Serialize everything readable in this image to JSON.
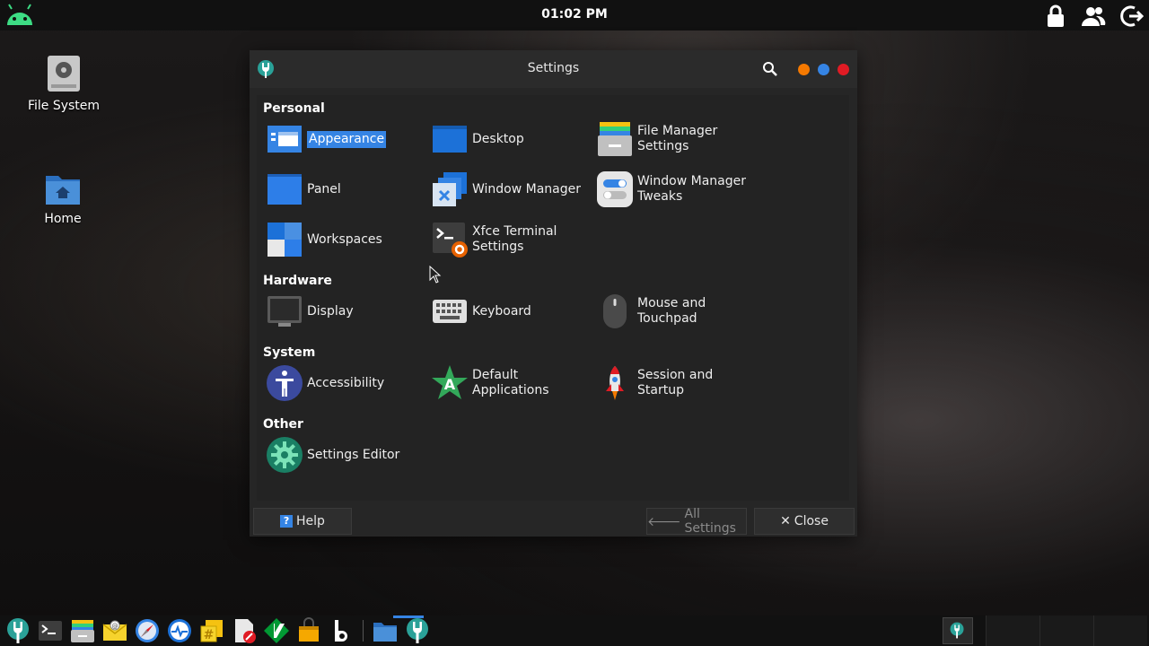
{
  "topbar": {
    "clock": "01:02 PM",
    "left_icon": "android-icon",
    "right_icons": [
      "lock-icon",
      "users-icon",
      "logout-icon"
    ]
  },
  "desktop": {
    "icons": [
      {
        "label": "File System",
        "icon": "drive-icon"
      },
      {
        "label": "Home",
        "icon": "home-folder-icon"
      }
    ]
  },
  "window": {
    "title": "Settings",
    "sections": [
      {
        "title": "Personal",
        "items": [
          {
            "label": "Appearance",
            "selected": true
          },
          {
            "label": "Desktop"
          },
          {
            "label": "File Manager Settings",
            "lines": [
              "File Manager",
              "Settings"
            ]
          },
          {
            "label": "Panel"
          },
          {
            "label": "Window Manager"
          },
          {
            "label": "Window Manager Tweaks",
            "lines": [
              "Window Manager",
              "Tweaks"
            ]
          },
          {
            "label": "Workspaces"
          },
          {
            "label": "Xfce Terminal Settings",
            "lines": [
              "Xfce Terminal",
              "Settings"
            ]
          }
        ]
      },
      {
        "title": "Hardware",
        "items": [
          {
            "label": "Display"
          },
          {
            "label": "Keyboard"
          },
          {
            "label": "Mouse and Touchpad",
            "lines": [
              "Mouse and",
              "Touchpad"
            ]
          }
        ]
      },
      {
        "title": "System",
        "items": [
          {
            "label": "Accessibility"
          },
          {
            "label": "Default Applications",
            "lines": [
              "Default",
              "Applications"
            ]
          },
          {
            "label": "Session and Startup",
            "lines": [
              "Session and",
              "Startup"
            ]
          }
        ]
      },
      {
        "title": "Other",
        "items": [
          {
            "label": "Settings Editor"
          }
        ]
      }
    ],
    "footer": {
      "help": "Help",
      "all_settings": "All Settings",
      "close": "Close"
    }
  },
  "taskbar": {
    "launchers": [
      "settings-icon",
      "terminal-icon",
      "file-manager-icon",
      "mail-icon",
      "web-browser-icon",
      "task-manager-icon",
      "hashtag-icon",
      "document-edit-icon",
      "vim-icon",
      "package-icon",
      "bold-b-icon",
      "folder-icon",
      "settings-active-icon"
    ]
  },
  "colors": {
    "accent": "#3584e4",
    "minimize": "#f57900",
    "close": "#e01b24"
  }
}
